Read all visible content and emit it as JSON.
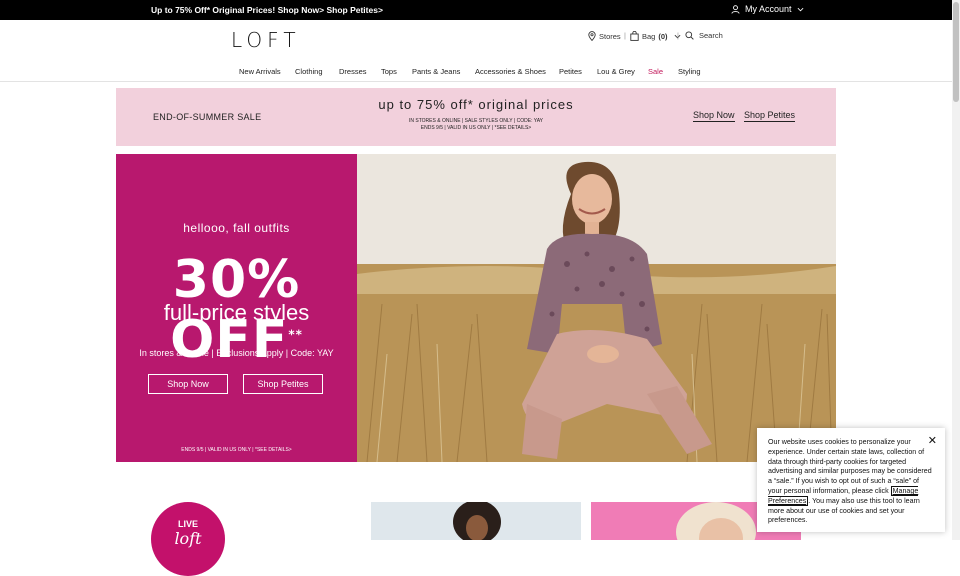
{
  "promo_bar": {
    "text": "Up to 75% Off* Original Prices! Shop Now> Shop Petites>",
    "account_label": "My Account"
  },
  "header": {
    "logo": "LOFT",
    "stores_label": "Stores",
    "bag_label": "Bag",
    "bag_count": "(0)",
    "search_label": "Search"
  },
  "nav": {
    "items": [
      "New Arrivals",
      "Clothing",
      "Dresses",
      "Tops",
      "Pants & Jeans",
      "Accessories & Shoes",
      "Petites",
      "Lou & Grey",
      "Sale",
      "Styling"
    ]
  },
  "sale_banner": {
    "left_text": "END-OF-SUMMER SALE",
    "headline": "up to 75% off* original prices",
    "line1": "IN STORES & ONLINE | SALE STYLES ONLY | CODE: YAY",
    "line2": "ENDS 9/5 | VALID IN US ONLY | *SEE DETAILS>",
    "shop_now": "Shop Now",
    "shop_petites": "Shop Petites"
  },
  "hero": {
    "eyebrow": "hellooo, fall outfits",
    "big": "30% OFF",
    "big_sup": "**",
    "sub": "full-price styles",
    "info": "In stores & online | Exclusions apply | Code: YAY",
    "shop_now": "Shop Now",
    "shop_petites": "Shop Petites",
    "fine_print": "ENDS 9/5 | VALID IN US ONLY | *SEE DETAILS>"
  },
  "cookie": {
    "text_before": "Our website uses cookies to personalize your experience. Under certain state laws, collection of data through third-party cookies for targeted advertising and similar purposes may be considered a “sale.” If you wish to opt out of such a “sale” of your personal information, please click ",
    "manage_link": "Manage Preferences",
    "text_after": ". You may also use this tool to learn more about our use of cookies and set your preferences.",
    "close_icon": "close-icon"
  },
  "bottom": {
    "live_label": "LIVE",
    "live_script": "loft"
  },
  "colors": {
    "brand_pink": "#b8186e",
    "banner_pink": "#f2d0dc",
    "sale_nav": "#c2185b",
    "promo_bg": "#000000"
  }
}
